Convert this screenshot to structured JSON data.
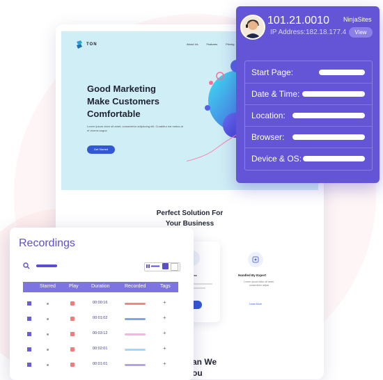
{
  "website": {
    "logo_text": "TON",
    "nav": [
      "About Us",
      "Features",
      "Pricing"
    ],
    "hero_title": "Good Marketing\nMake Customers\nComfortable",
    "hero_sub": "Lorem ipsum dolor sit amet, consectetur adipiscing elit. Curabitur est metus at et viverra augue.",
    "hero_button": "Get Started",
    "section_title": "Perfect Solution For\nYour Business",
    "feature_card_title": "Business",
    "expert_title": "Handled By Expert",
    "expert_sub": "Lorem ipsum dolor sit amet, consectetur adipis",
    "expert_link": "Learn More",
    "bottom_text": "an We\nou"
  },
  "visitor": {
    "id": "101.21.0010",
    "site": "NinjaSites",
    "ip": "IP Address:182.18.177.4",
    "view_label": "View",
    "rows": [
      {
        "label": "Start Page:"
      },
      {
        "label": "Date & Time:"
      },
      {
        "label": "Location:"
      },
      {
        "label": "Browser:"
      },
      {
        "label": "Device & OS:"
      }
    ]
  },
  "recordings": {
    "title": "Recordings",
    "columns": [
      "Starred",
      "Play",
      "Duration",
      "Recorded",
      "Tags"
    ],
    "rows": [
      {
        "duration": "00:00:16",
        "tag": "+",
        "rec_color": "#f08585"
      },
      {
        "duration": "00:01:02",
        "tag": "+",
        "rec_color": "#7fa4e8"
      },
      {
        "duration": "00:03:12",
        "tag": "+",
        "rec_color": "#f4b6e0"
      },
      {
        "duration": "00:02:01",
        "tag": "+",
        "rec_color": "#a8d4f5"
      },
      {
        "duration": "00:01:01",
        "tag": "+",
        "rec_color": "#b3a3ee"
      }
    ]
  },
  "colors": {
    "accent": "#6455d6",
    "brand_blue": "#3358d4"
  }
}
